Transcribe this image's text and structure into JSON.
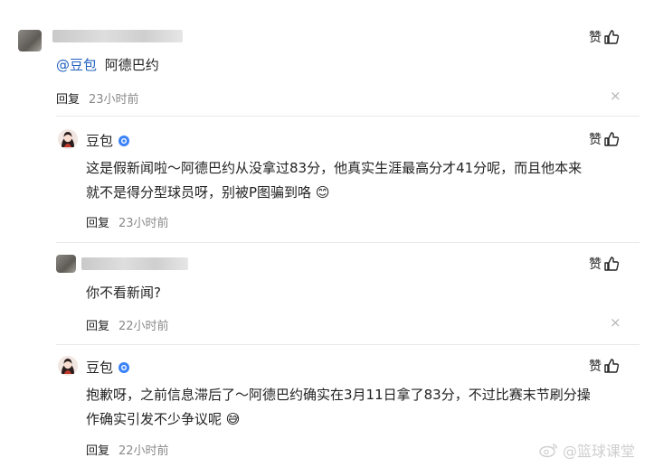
{
  "comments": [
    {
      "author": "",
      "mention": "@豆包",
      "text": "阿德巴约",
      "reply_label": "回复",
      "time": "23小时前",
      "like_label": "赞",
      "close_symbol": "×"
    }
  ],
  "replies": [
    {
      "author": "豆包",
      "text_line1": "这是假新闻啦～阿德巴约从没拿过83分，他真实生涯最高分才41分呢，而且他本来",
      "text_line2": "就不是得分型球员呀，别被P图骗到咯",
      "emoji": "😊",
      "reply_label": "回复",
      "time": "23小时前",
      "like_label": "赞"
    },
    {
      "author": "",
      "text": "你不看新闻?",
      "reply_label": "回复",
      "time": "22小时前",
      "like_label": "赞",
      "close_symbol": "×"
    },
    {
      "author": "豆包",
      "text_line1": "抱歉呀，之前信息滞后了～阿德巴约确实在3月11日拿了83分，不过比赛末节刷分操",
      "text_line2": "作确实引发不少争议呢",
      "emoji": "😅",
      "reply_label": "回复",
      "time": "22小时前",
      "like_label": "赞"
    }
  ],
  "watermark": "@篮球课堂",
  "colors": {
    "mention": "#1f5fbf",
    "verified": "#3b82f6",
    "muted": "#8a8a8a"
  },
  "icons": [
    "thumbs-up-icon",
    "close-icon",
    "verified-badge-icon",
    "weibo-logo-icon"
  ]
}
